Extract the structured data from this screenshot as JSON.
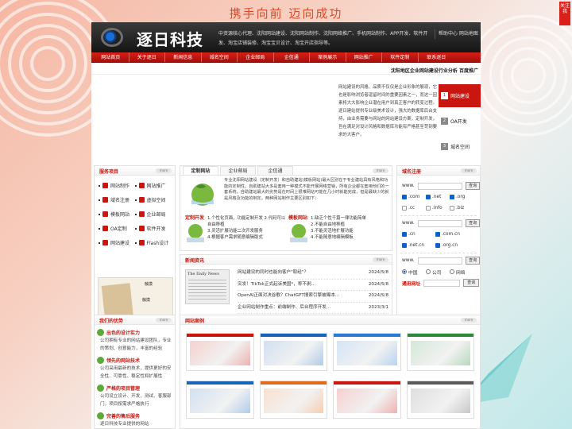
{
  "slogan": "携手向前 迈向成功",
  "side_tab": "关注我",
  "header": {
    "logo_text": "逐日科技",
    "intro": "中资源核心代理、沈阳网站建设、沈阳网站制作、沈阳网络推广、手机网站制作、APP开发、软件开发、淘宝店铺装修、淘宝宝贝设计、淘宝开店指导等。",
    "links": "帮助中心 网站地图"
  },
  "nav": [
    "网站首页",
    "关于逐日",
    "新闻信息",
    "城名空间",
    "企业邮局",
    "企信通",
    "案例展示",
    "网站推广",
    "软件定制",
    "联系逐日"
  ],
  "ticker": "沈阳地区企业网站建设行业分析    百度推广",
  "banner": {
    "text": "网站建设的风格、品质不仅仅是企业形象的展现，它也是影响浏览者逗留时间的重要因素之一，而这一因素将大大影响企业潜在用户到真正客户的转变过程。逐日建站提供专业级美术设计，强大的数据库后台支持，由业务需要与网站的网站建设方案，定制开发，旨在满足对设计风格和数据库功能有严格甚至苛刻要求的大客户。",
    "tabs": [
      {
        "num": "1",
        "label": "网站建设"
      },
      {
        "num": "2",
        "label": "OA开发"
      },
      {
        "num": "3",
        "label": "城名空间"
      }
    ]
  },
  "services": {
    "title": "服务项目",
    "more": "more",
    "items": [
      "网站制作",
      "网站推广",
      "域名注册",
      "虚拟空间",
      "模板网站",
      "企业邮局",
      "OA定制",
      "软件开发",
      "网站建设",
      "Flash设计"
    ],
    "images": [
      "触摸",
      "触摸",
      "触摸"
    ]
  },
  "site_types": {
    "tabs": [
      "定制网站",
      "企业邮局",
      "企信通"
    ],
    "more": "more",
    "intro": "专业沈阳网站建设（定制开发）和自助建站(模板网站)最大区别在于专业建站具有风格和功能的定制性。自助建站大多是套用一种模式不能开展网络营销，所有企业都在套用他们的一套系统，自助建站最大的劣势是在时间上很难网站可能在几小时就能完成，但是最缺少的就是风格及功能的制定。两种网站制作主要区别如下：",
    "custom_title": "定制开发",
    "custom_points": [
      "1.个性化页面，功能定制开发 2.代码可以自由移植",
      "3.灵活扩展功能二次开发服务",
      "4.根据客户需求随意编辑版式"
    ],
    "template_title": "模板网站",
    "template_points": [
      "1.缺乏个性千篇一律功能简单",
      "2.不能自由地移植",
      "3.不能灵活地扩展功能",
      "4.不能随意地编辑模板"
    ]
  },
  "news": {
    "title": "新闻资讯",
    "more": "more",
    "paper_label": "The Daily News",
    "items": [
      {
        "title": "网站建设的同时也能向客户\"取经\"？",
        "date": "2024/5/8"
      },
      {
        "title": "突发！TikTok正式起诉美国*，称不剥...",
        "date": "2024/5/8"
      },
      {
        "title": "OpenAI正面对决谷歌？ChatGPT搜索引擎被曝本...",
        "date": "2024/5/8"
      },
      {
        "title": "企业网站制作重点：前端制作、后台程序开发...",
        "date": "2023/3/1"
      }
    ]
  },
  "domain": {
    "title": "域名注册",
    "more": "more",
    "prefix": "www.",
    "query": "查询",
    "row1": [
      ".com",
      ".net",
      ".org"
    ],
    "row2": [
      ".cc",
      ".info",
      ".biz"
    ],
    "row3": [
      ".cn",
      ".com.cn"
    ],
    "row4": [
      ".net.cn",
      ".org.cn"
    ],
    "row5": [
      "中国",
      "公司",
      "网络"
    ],
    "general": "通用网址"
  },
  "advantages": {
    "title": "我们的优势",
    "more": "more",
    "items": [
      {
        "h": "出色的设计实力",
        "d": "公司拥有专业的网站建设团队，专业的策划、创意能力，丰富的经验"
      },
      {
        "h": "领先的网站技术",
        "d": "公司采用最新的技术，提供更好的安全性、可靠性、稳定性和扩展性"
      },
      {
        "h": "严格的项目管理",
        "d": "公司设立设计、开发、测试、客服部门，项目按需求严格执行"
      },
      {
        "h": "完善的售后服务",
        "d": "逐日科技专业提供的网站"
      }
    ]
  },
  "cases": {
    "title": "网站案例",
    "more": "more",
    "colors": [
      "#c9170f",
      "#1a64b8",
      "#2a7bd3",
      "#2a8c3a",
      "#1a64b8",
      "#e06a1c",
      "#c9170f",
      "#5a5a5a"
    ]
  }
}
